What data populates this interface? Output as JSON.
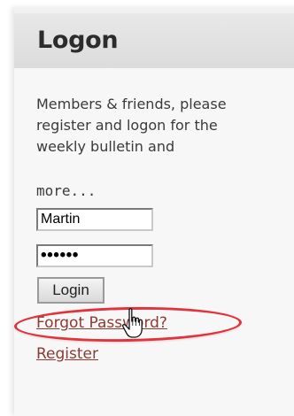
{
  "logon": {
    "title": "Logon",
    "intro_lines": [
      "Members & friends, please",
      "register and logon for the",
      "weekly bulletin and"
    ],
    "intro_more": "more...",
    "username_value": "Martin",
    "password_value": "••••••",
    "login_label": "Login",
    "forgot_label": "Forgot Password?",
    "register_label": "Register"
  },
  "colors": {
    "link": "#8b3a33",
    "highlight": "#e0333d"
  },
  "icons": {
    "cursor": "hand-pointer-icon"
  }
}
